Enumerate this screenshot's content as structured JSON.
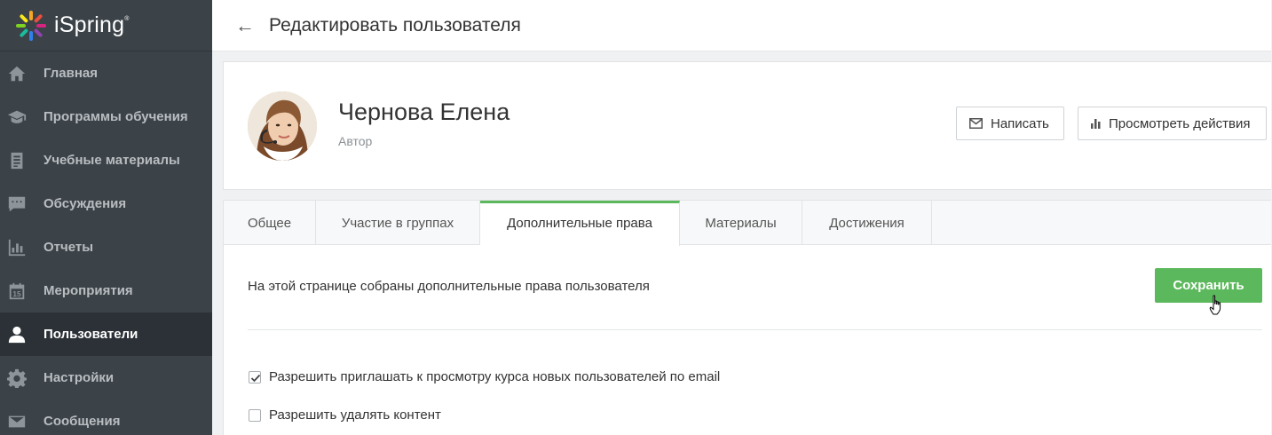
{
  "sidebar": {
    "logo_text": "iSpring",
    "logo_mark": "®",
    "items": [
      {
        "label": "Главная",
        "icon": "home-icon"
      },
      {
        "label": "Программы обучения",
        "icon": "graduation-cap-icon"
      },
      {
        "label": "Учебные материалы",
        "icon": "document-icon"
      },
      {
        "label": "Обсуждения",
        "icon": "chat-icon"
      },
      {
        "label": "Отчеты",
        "icon": "bar-chart-icon"
      },
      {
        "label": "Мероприятия",
        "icon": "calendar-icon"
      },
      {
        "label": "Пользователи",
        "icon": "user-icon",
        "active": true
      },
      {
        "label": "Настройки",
        "icon": "gear-icon"
      },
      {
        "label": "Сообщения",
        "icon": "envelope-icon"
      }
    ],
    "calendar_day": "15"
  },
  "header": {
    "title": "Редактировать пользователя"
  },
  "profile": {
    "name": "Чернова Елена",
    "role": "Автор",
    "write_button": "Написать",
    "actions_button": "Просмотреть действия"
  },
  "tabs": [
    {
      "label": "Общее"
    },
    {
      "label": "Участие в группах"
    },
    {
      "label": "Дополнительные права",
      "active": true
    },
    {
      "label": "Материалы"
    },
    {
      "label": "Достижения"
    }
  ],
  "content": {
    "info": "На этой странице собраны дополнительные права пользователя",
    "save_button": "Сохранить",
    "permissions": [
      {
        "label": "Разрешить приглашать к просмотру курса новых пользователей по email",
        "checked": true
      },
      {
        "label": "Разрешить удалять контент",
        "checked": false
      }
    ]
  },
  "colors": {
    "sidebar_bg": "#3b4349",
    "sidebar_active_bg": "#2b3136",
    "accent_green": "#5cb85c"
  }
}
